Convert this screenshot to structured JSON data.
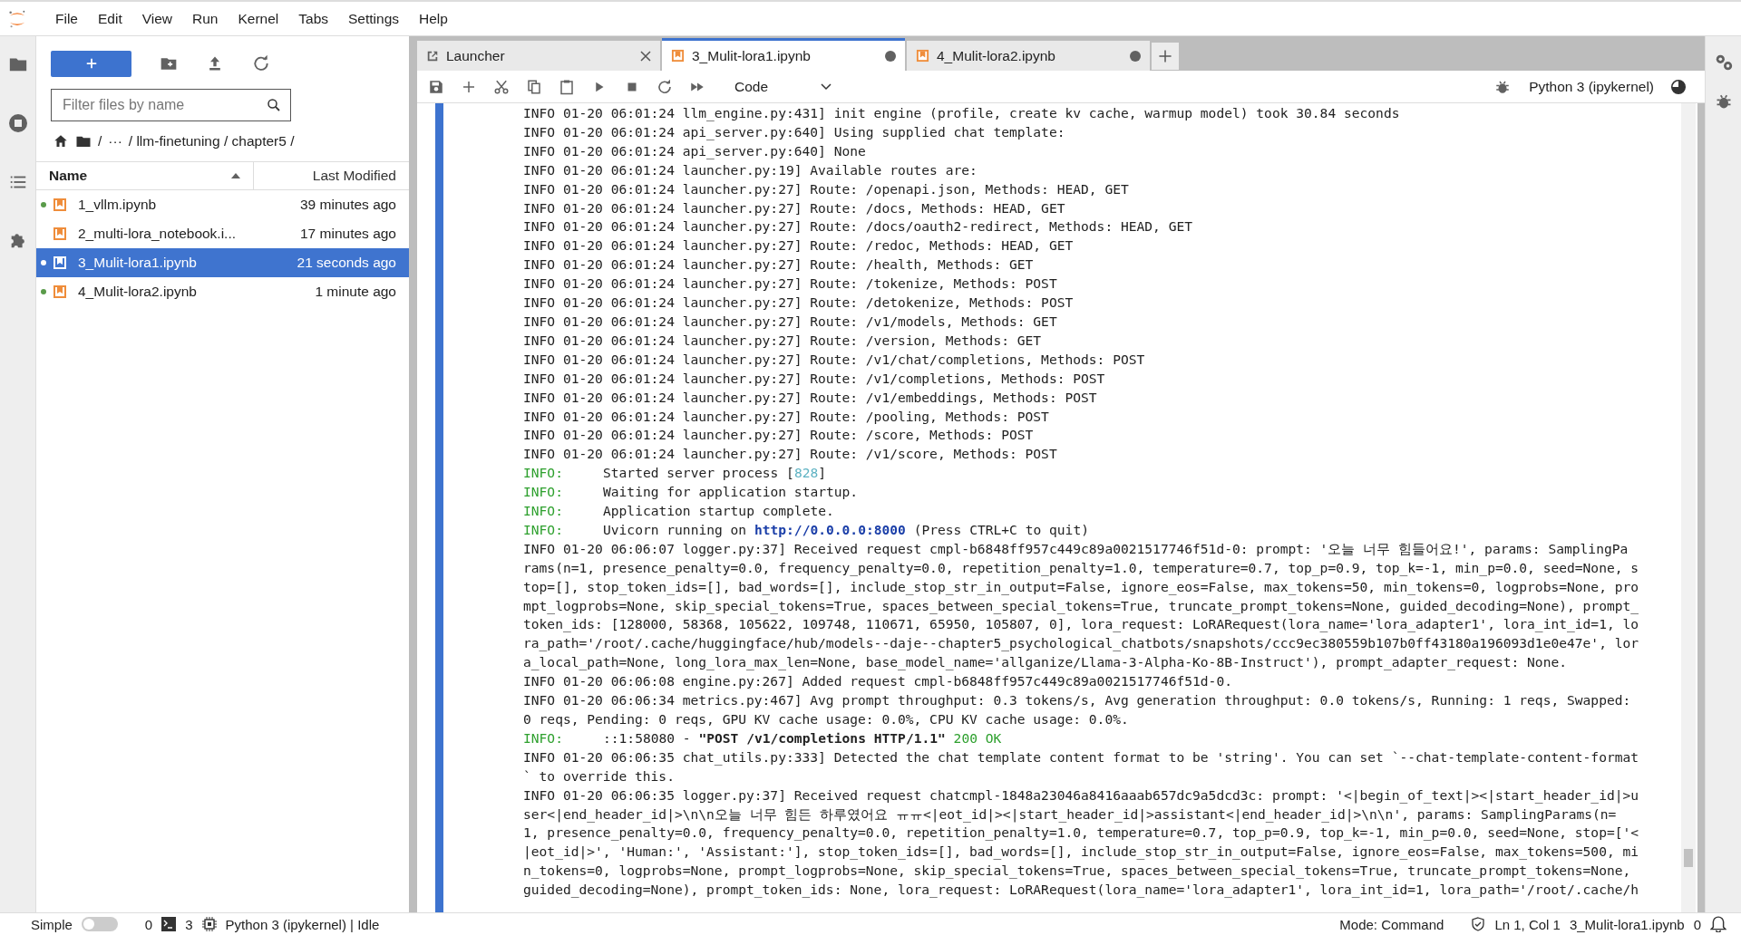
{
  "menu": [
    "File",
    "Edit",
    "View",
    "Run",
    "Kernel",
    "Tabs",
    "Settings",
    "Help"
  ],
  "file_browser": {
    "filter_placeholder": "Filter files by name",
    "breadcrumb": [
      {
        "kind": "home"
      },
      {
        "kind": "root",
        "text": "/"
      },
      {
        "kind": "text",
        "text": "···"
      },
      {
        "kind": "text",
        "text": "/ llm-finetuning / chapter5 /"
      }
    ],
    "columns": [
      {
        "label": "Name",
        "sorted": true
      },
      {
        "label": "Last Modified",
        "sorted": false
      }
    ],
    "files": [
      {
        "name": "1_vllm.ipynb",
        "modified": "39 minutes ago",
        "running": true,
        "selected": false
      },
      {
        "name": "2_multi-lora_notebook.i...",
        "modified": "17 minutes ago",
        "running": false,
        "selected": false
      },
      {
        "name": "3_Mulit-lora1.ipynb",
        "modified": "21 seconds ago",
        "running": true,
        "selected": true
      },
      {
        "name": "4_Mulit-lora2.ipynb",
        "modified": "1 minute ago",
        "running": true,
        "selected": false
      }
    ]
  },
  "tabs": [
    {
      "kind": "launcher",
      "label": "Launcher",
      "selected": false,
      "dirty": false
    },
    {
      "kind": "notebook",
      "label": "3_Mulit-lora1.ipynb",
      "selected": true,
      "dirty": true
    },
    {
      "kind": "notebook",
      "label": "4_Mulit-lora2.ipynb",
      "selected": false,
      "dirty": true
    }
  ],
  "toolbar": {
    "cell_type": "Code",
    "kernel": "Python 3 (ipykernel)"
  },
  "output": [
    {
      "kind": "plain",
      "text": "INFO 01-20 06:01:24 llm_engine.py:431] init engine (profile, create kv cache, warmup model) took 30.84 seconds"
    },
    {
      "kind": "plain",
      "text": "INFO 01-20 06:01:24 api_server.py:640] Using supplied chat template:"
    },
    {
      "kind": "plain",
      "text": "INFO 01-20 06:01:24 api_server.py:640] None"
    },
    {
      "kind": "plain",
      "text": "INFO 01-20 06:01:24 launcher.py:19] Available routes are:"
    },
    {
      "kind": "plain",
      "text": "INFO 01-20 06:01:24 launcher.py:27] Route: /openapi.json, Methods: HEAD, GET"
    },
    {
      "kind": "plain",
      "text": "INFO 01-20 06:01:24 launcher.py:27] Route: /docs, Methods: HEAD, GET"
    },
    {
      "kind": "plain",
      "text": "INFO 01-20 06:01:24 launcher.py:27] Route: /docs/oauth2-redirect, Methods: HEAD, GET"
    },
    {
      "kind": "plain",
      "text": "INFO 01-20 06:01:24 launcher.py:27] Route: /redoc, Methods: HEAD, GET"
    },
    {
      "kind": "plain",
      "text": "INFO 01-20 06:01:24 launcher.py:27] Route: /health, Methods: GET"
    },
    {
      "kind": "plain",
      "text": "INFO 01-20 06:01:24 launcher.py:27] Route: /tokenize, Methods: POST"
    },
    {
      "kind": "plain",
      "text": "INFO 01-20 06:01:24 launcher.py:27] Route: /detokenize, Methods: POST"
    },
    {
      "kind": "plain",
      "text": "INFO 01-20 06:01:24 launcher.py:27] Route: /v1/models, Methods: GET"
    },
    {
      "kind": "plain",
      "text": "INFO 01-20 06:01:24 launcher.py:27] Route: /version, Methods: GET"
    },
    {
      "kind": "plain",
      "text": "INFO 01-20 06:01:24 launcher.py:27] Route: /v1/chat/completions, Methods: POST"
    },
    {
      "kind": "plain",
      "text": "INFO 01-20 06:01:24 launcher.py:27] Route: /v1/completions, Methods: POST"
    },
    {
      "kind": "plain",
      "text": "INFO 01-20 06:01:24 launcher.py:27] Route: /v1/embeddings, Methods: POST"
    },
    {
      "kind": "plain",
      "text": "INFO 01-20 06:01:24 launcher.py:27] Route: /pooling, Methods: POST"
    },
    {
      "kind": "plain",
      "text": "INFO 01-20 06:01:24 launcher.py:27] Route: /score, Methods: POST"
    },
    {
      "kind": "plain",
      "text": "INFO 01-20 06:01:24 launcher.py:27] Route: /v1/score, Methods: POST"
    },
    {
      "kind": "uvicorn",
      "level": "INFO:",
      "parts": [
        {
          "kind": "text",
          "text": "Started server process ["
        },
        {
          "kind": "pid",
          "text": "828"
        },
        {
          "kind": "text",
          "text": "]"
        }
      ]
    },
    {
      "kind": "uvicorn",
      "level": "INFO:",
      "parts": [
        {
          "kind": "text",
          "text": "Waiting for application startup."
        }
      ]
    },
    {
      "kind": "uvicorn",
      "level": "INFO:",
      "parts": [
        {
          "kind": "text",
          "text": "Application startup complete."
        }
      ]
    },
    {
      "kind": "uvicorn",
      "level": "INFO:",
      "parts": [
        {
          "kind": "text",
          "text": "Uvicorn running on "
        },
        {
          "kind": "link",
          "text": "http://0.0.0.0:8000"
        },
        {
          "kind": "text",
          "text": " (Press CTRL+C to quit)"
        }
      ]
    },
    {
      "kind": "plain",
      "text": "INFO 01-20 06:06:07 logger.py:37] Received request cmpl-b6848ff957c449c89a0021517746f51d-0: prompt: '오늘 너무 힘들어요!', params: SamplingPa"
    },
    {
      "kind": "plain",
      "text": "rams(n=1, presence_penalty=0.0, frequency_penalty=0.0, repetition_penalty=1.0, temperature=0.7, top_p=0.9, top_k=-1, min_p=0.0, seed=None, s"
    },
    {
      "kind": "plain",
      "text": "top=[], stop_token_ids=[], bad_words=[], include_stop_str_in_output=False, ignore_eos=False, max_tokens=50, min_tokens=0, logprobs=None, pro"
    },
    {
      "kind": "plain",
      "text": "mpt_logprobs=None, skip_special_tokens=True, spaces_between_special_tokens=True, truncate_prompt_tokens=None, guided_decoding=None), prompt_"
    },
    {
      "kind": "plain",
      "text": "token_ids: [128000, 58368, 105622, 109748, 110671, 65950, 105807, 0], lora_request: LoRARequest(lora_name='lora_adapter1', lora_int_id=1, lo"
    },
    {
      "kind": "plain",
      "text": "ra_path='/root/.cache/huggingface/hub/models--daje--chapter5_psychological_chatbots/snapshots/ccc9ec380559b107b0ff43180a196093d1e0e47e', lor"
    },
    {
      "kind": "plain",
      "text": "a_local_path=None, long_lora_max_len=None, base_model_name='allganize/Llama-3-Alpha-Ko-8B-Instruct'), prompt_adapter_request: None."
    },
    {
      "kind": "plain",
      "text": "INFO 01-20 06:06:08 engine.py:267] Added request cmpl-b6848ff957c449c89a0021517746f51d-0."
    },
    {
      "kind": "plain",
      "text": "INFO 01-20 06:06:34 metrics.py:467] Avg prompt throughput: 0.3 tokens/s, Avg generation throughput: 0.0 tokens/s, Running: 1 reqs, Swapped:"
    },
    {
      "kind": "plain",
      "text": "0 reqs, Pending: 0 reqs, GPU KV cache usage: 0.0%, CPU KV cache usage: 0.0%."
    },
    {
      "kind": "uvicorn",
      "level": "INFO:",
      "parts": [
        {
          "kind": "text",
          "text": "::1:58080 - "
        },
        {
          "kind": "bold",
          "text": "\"POST /v1/completions HTTP/1.1\""
        },
        {
          "kind": "status",
          "text": "200 OK"
        }
      ]
    },
    {
      "kind": "plain",
      "text": "INFO 01-20 06:06:35 chat_utils.py:333] Detected the chat template content format to be 'string'. You can set `--chat-template-content-format"
    },
    {
      "kind": "plain",
      "text": "` to override this."
    },
    {
      "kind": "plain",
      "text": "INFO 01-20 06:06:35 logger.py:37] Received request chatcmpl-1848a23046a8416aaab657dc9a5dcd3c: prompt: '<|begin_of_text|><|start_header_id|>u"
    },
    {
      "kind": "plain",
      "text": "ser<|end_header_id|>\\n\\n오늘 너무 힘든 하루였어요 ㅠㅠ<|eot_id|><|start_header_id|>assistant<|end_header_id|>\\n\\n', params: SamplingParams(n="
    },
    {
      "kind": "plain",
      "text": "1, presence_penalty=0.0, frequency_penalty=0.0, repetition_penalty=1.0, temperature=0.7, top_p=0.9, top_k=-1, min_p=0.0, seed=None, stop=['<"
    },
    {
      "kind": "plain",
      "text": "|eot_id|>', 'Human:', 'Assistant:'], stop_token_ids=[], bad_words=[], include_stop_str_in_output=False, ignore_eos=False, max_tokens=500, mi"
    },
    {
      "kind": "plain",
      "text": "n_tokens=0, logprobs=None, prompt_logprobs=None, skip_special_tokens=True, spaces_between_special_tokens=True, truncate_prompt_tokens=None,"
    },
    {
      "kind": "plain",
      "text": "guided_decoding=None), prompt_token_ids: None, lora_request: LoRARequest(lora_name='lora_adapter1', lora_int_id=1, lora_path='/root/.cache/h"
    }
  ],
  "status_bar": {
    "mode_label": "Simple",
    "simple_mode": false,
    "kernels": "0",
    "terminals": "3",
    "kernel_status": "Python 3 (ipykernel) | Idle",
    "mode": "Mode: Command",
    "position": "Ln 1, Col 1",
    "file": "3_Mulit-lora1.ipynb",
    "notifications": "0"
  }
}
